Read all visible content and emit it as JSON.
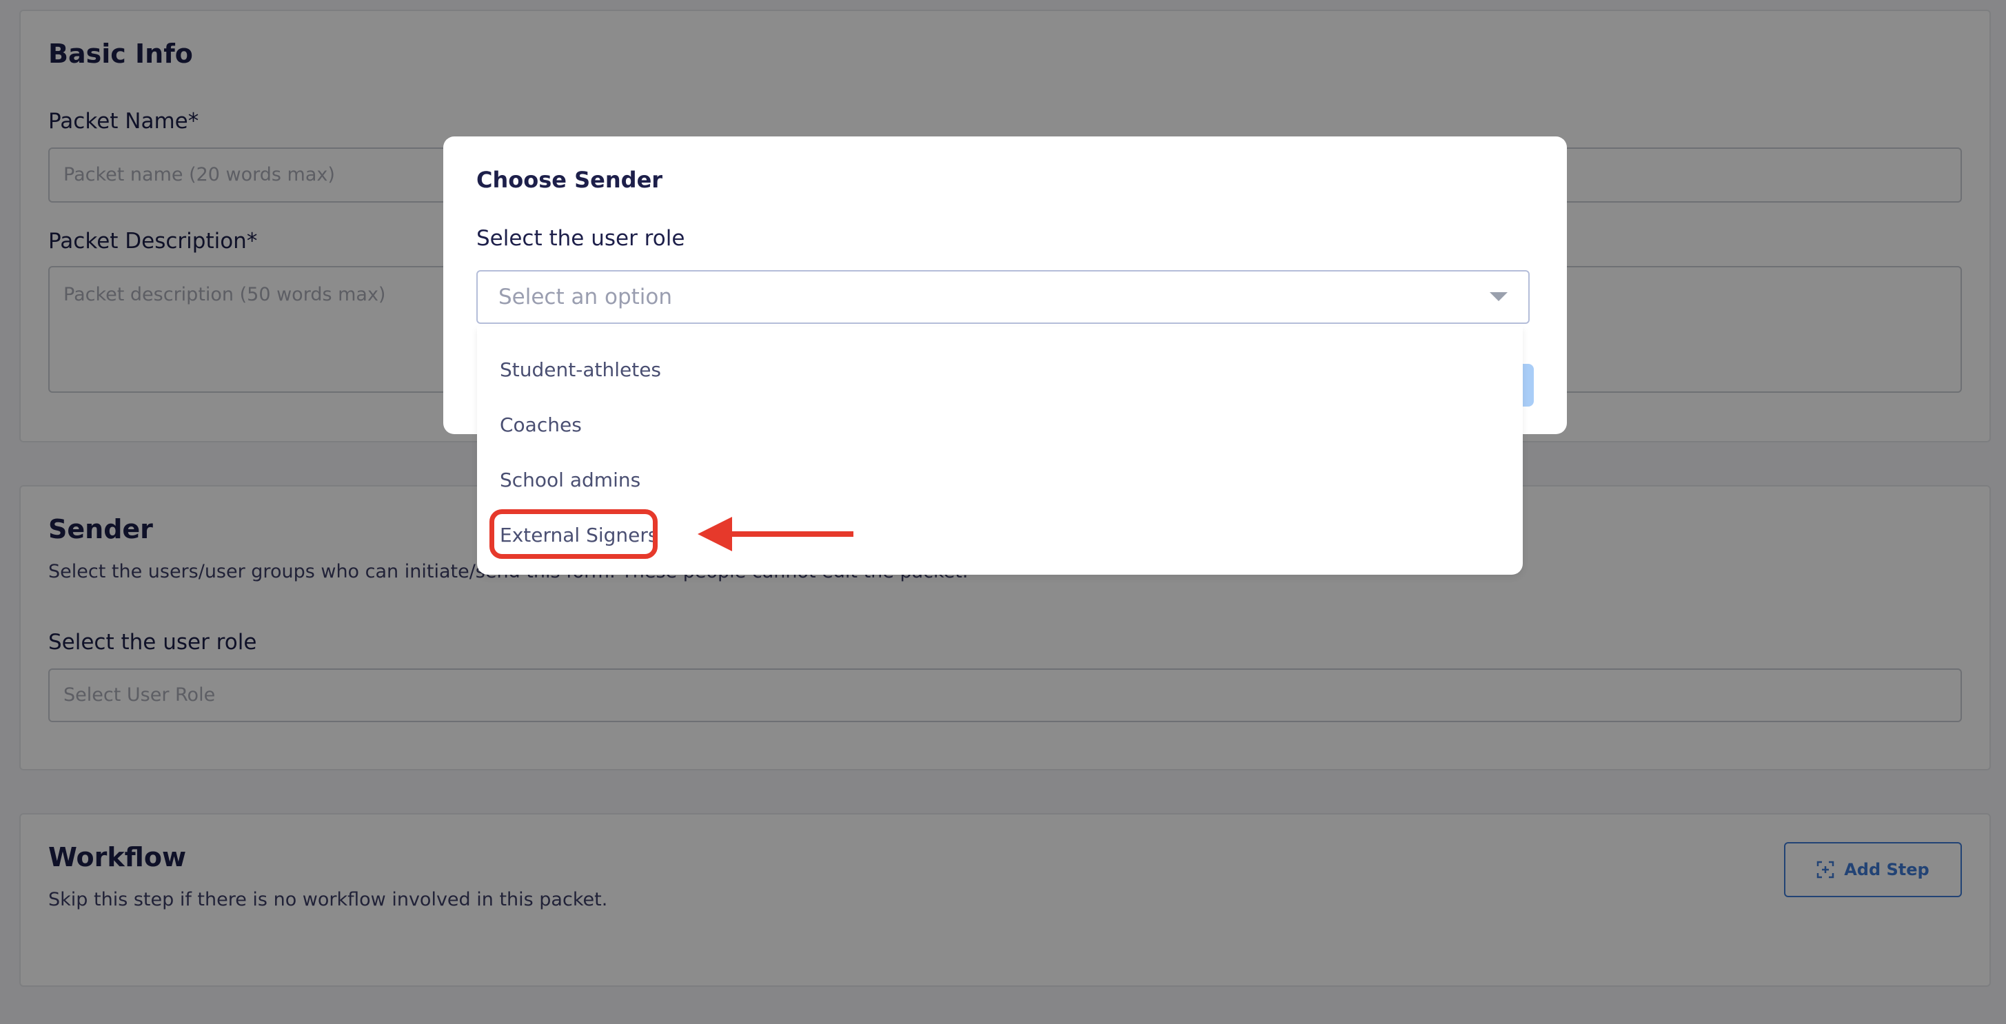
{
  "basic_info": {
    "title": "Basic Info",
    "packet_name_label": "Packet Name*",
    "packet_name_placeholder": "Packet name (20 words max)",
    "packet_description_label": "Packet Description*",
    "packet_description_placeholder": "Packet description (50 words max)"
  },
  "sender": {
    "title": "Sender",
    "description": "Select the users/user groups who can initiate/send this form. These people cannot edit the packet.",
    "role_label": "Select the user role",
    "role_placeholder": "Select User Role"
  },
  "workflow": {
    "title": "Workflow",
    "description": "Skip this step if there is no workflow involved in this packet.",
    "add_step_label": "Add Step"
  },
  "modal": {
    "title": "Choose Sender",
    "role_label": "Select the user role",
    "select_placeholder": "Select an option",
    "options": [
      "Student-athletes",
      "Coaches",
      "School admins",
      "External Signers"
    ],
    "highlighted_option": "External Signers"
  },
  "colors": {
    "annotation": "#e6392b",
    "accent": "#3f7bd6",
    "primary_text": "#1d1f4a"
  }
}
